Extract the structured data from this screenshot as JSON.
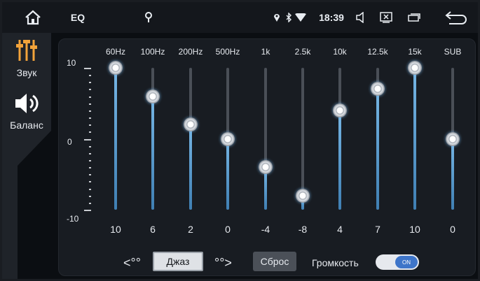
{
  "statusbar": {
    "app_title": "EQ",
    "time": "18:39"
  },
  "sidebar": {
    "items": [
      {
        "label": "Звук",
        "icon": "sliders-icon",
        "active": true,
        "color": "#f2a33a"
      },
      {
        "label": "Баланс",
        "icon": "speaker-icon",
        "active": false
      }
    ]
  },
  "scale": {
    "top": "10",
    "mid": "0",
    "bottom": "-10"
  },
  "bands": [
    {
      "freq": "60Hz",
      "value": "10",
      "level": 10
    },
    {
      "freq": "100Hz",
      "value": "6",
      "level": 6
    },
    {
      "freq": "200Hz",
      "value": "2",
      "level": 2
    },
    {
      "freq": "500Hz",
      "value": "0",
      "level": 0
    },
    {
      "freq": "1k",
      "value": "-4",
      "level": -4
    },
    {
      "freq": "2.5k",
      "value": "-8",
      "level": -8
    },
    {
      "freq": "10k",
      "value": "4",
      "level": 4
    },
    {
      "freq": "12.5k",
      "value": "7",
      "level": 7
    },
    {
      "freq": "15k",
      "value": "10",
      "level": 10
    },
    {
      "freq": "SUB",
      "value": "0",
      "level": 0
    }
  ],
  "controls": {
    "prev_arrow": "<°°",
    "preset": "Джаз",
    "next_arrow": "°°>",
    "reset": "Сброс",
    "loudness_label": "Громкость",
    "loudness_toggle": "ON"
  },
  "colors": {
    "accent": "#77b7e6",
    "toggle_on": "#3e75c9",
    "active_icon": "#f2a33a"
  }
}
